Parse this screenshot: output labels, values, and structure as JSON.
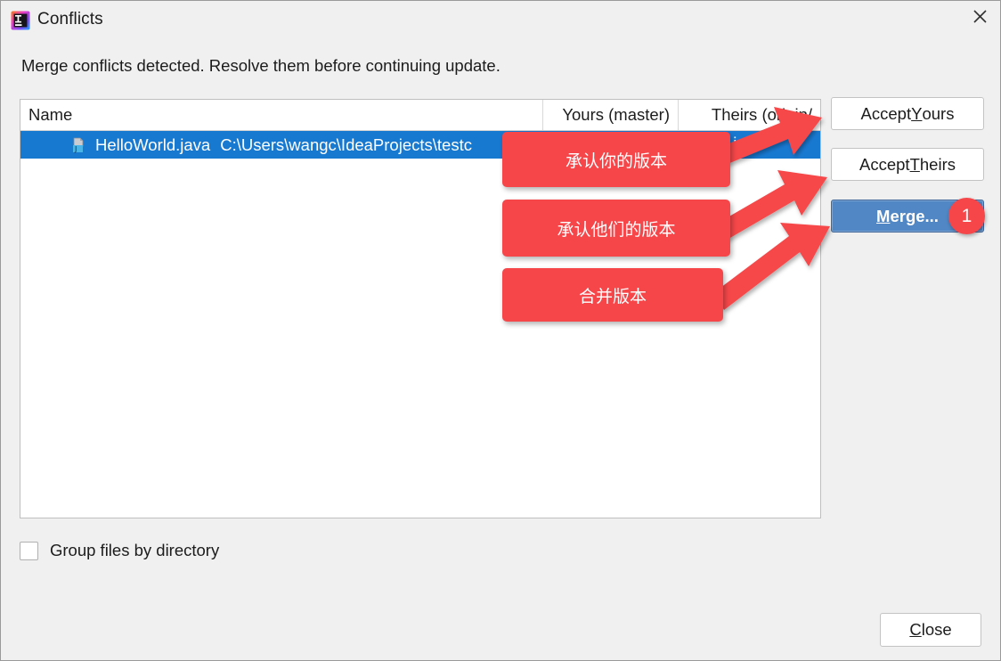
{
  "window": {
    "title": "Conflicts",
    "app_icon": "intellij-idea-icon",
    "close_icon": "close-icon"
  },
  "message": "Merge conflicts detected. Resolve them before continuing update.",
  "table": {
    "columns": [
      "Name",
      "Yours (master)",
      "Theirs (origin/"
    ],
    "rows": [
      {
        "icon": "java-file-icon",
        "name": "HelloWorld.java",
        "path": "C:\\Users\\wangc\\IdeaProjects\\testc",
        "yours": "",
        "theirs": "ied"
      }
    ]
  },
  "side_buttons": {
    "accept_yours": {
      "pre": "Accept ",
      "mnemonic": "Y",
      "post": "ours"
    },
    "accept_theirs": {
      "pre": "Accept ",
      "mnemonic": "T",
      "post": "heirs"
    },
    "merge": {
      "pre": "",
      "mnemonic": "M",
      "post": "erge...",
      "badge": "1"
    }
  },
  "options": {
    "group_files_label": "Group files by directory",
    "group_files_checked": false
  },
  "footer": {
    "close": {
      "pre": "",
      "mnemonic": "C",
      "post": "lose"
    }
  },
  "annotations": {
    "callouts": [
      {
        "text": "承认你的版本",
        "points_to": "accept-yours-button"
      },
      {
        "text": "承认他们的版本",
        "points_to": "accept-theirs-button"
      },
      {
        "text": "合并版本",
        "points_to": "merge-button"
      }
    ],
    "accent_color": "#f6464a"
  },
  "colors": {
    "selection_blue": "#1879d1",
    "merge_blue": "#5187c4",
    "annotation_red": "#f6464a",
    "dialog_bg": "#f0f0f0"
  }
}
